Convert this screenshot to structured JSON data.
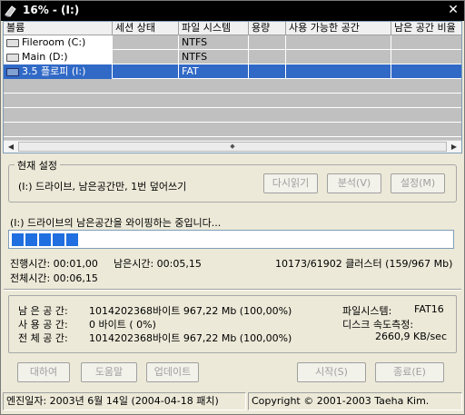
{
  "window": {
    "title": "16% - (I:)"
  },
  "list": {
    "columns": [
      "볼륨",
      "세션 상태",
      "파일 시스템",
      "용량",
      "사용 가능한 공간",
      "남은 공간 비율"
    ],
    "rows": [
      {
        "icon": "hard-drive-icon",
        "volume": "Fileroom (C:)",
        "session": "",
        "fs": "NTFS",
        "capacity": "",
        "free": "",
        "ratio": ""
      },
      {
        "icon": "hard-drive-icon",
        "volume": "Main (D:)",
        "session": "",
        "fs": "NTFS",
        "capacity": "",
        "free": "",
        "ratio": ""
      },
      {
        "icon": "floppy-drive-icon",
        "volume": "3.5 플로피 (I:)",
        "session": "",
        "fs": "FAT",
        "capacity": "",
        "free": "",
        "ratio": "",
        "selected": true
      }
    ]
  },
  "settings": {
    "group_title": "현재 설정",
    "description": "(I:) 드라이브, 남은공간만, 1번 덮어쓰기",
    "reread_label": "다시읽기",
    "analyze_label": "분석(V)",
    "config_label": "설정(M)"
  },
  "progress": {
    "status": "(I:) 드라이브의 남은공간을 와이핑하는 중입니다...",
    "percent": 16,
    "elapsed": "진행시간: 00:01,00",
    "remaining": "남은시간: 00:05,15",
    "clusters": "10173/61902 클러스터 (159/967 Mb)",
    "total": "전체시간: 00:06,15"
  },
  "info": {
    "free_label": "남 은 공 간:",
    "free_value": "1014202368바이트 967,22 Mb (100,00%)",
    "used_label": "사 용 공 간:",
    "used_value": "0 바이트 (  0%)",
    "total_label": "전 체 공 간:",
    "total_value": "1014202368바이트 967,22 Mb (100,00%)",
    "fs_label": "파일시스템:",
    "fs_value": "FAT16",
    "speed_label": "디스크 속도측정:",
    "speed_value": "2660,9 KB/sec"
  },
  "buttons": {
    "about": "대하여",
    "help": "도움말",
    "update": "업데이트",
    "start": "시작(S)",
    "exit": "종료(E)"
  },
  "statusbar": {
    "engine": "엔진일자: 2003년 6월 14일 (2004-04-18 패치)",
    "copyright": "Copyright © 2001-2003 Taeha Kim."
  }
}
